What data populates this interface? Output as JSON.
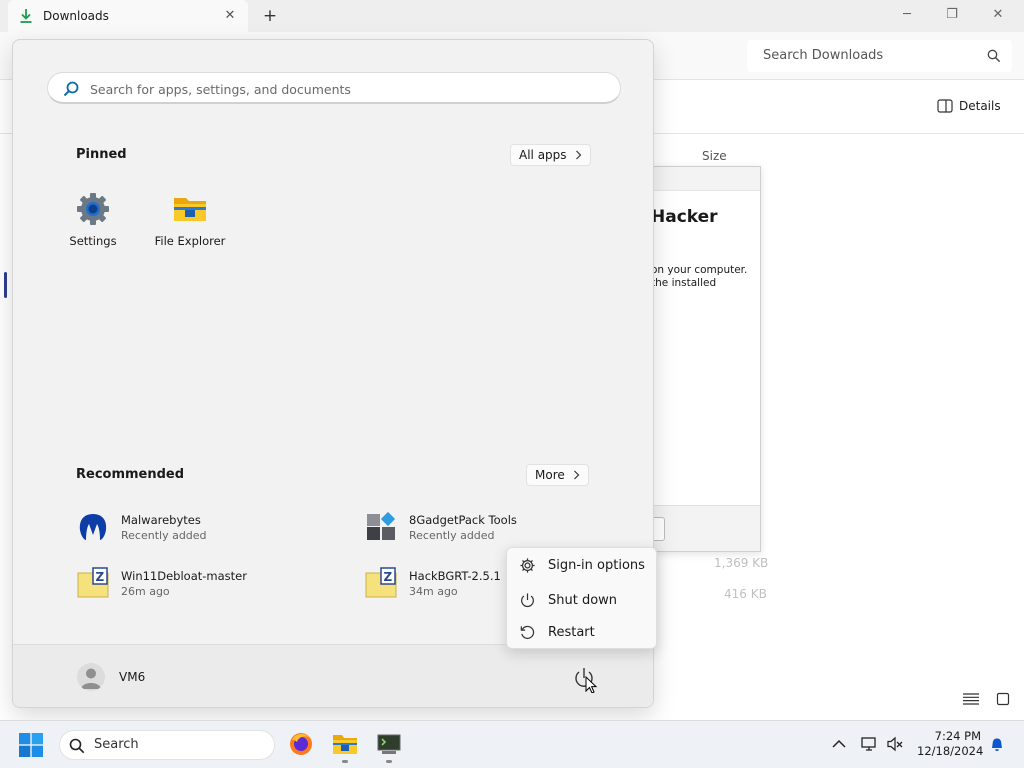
{
  "explorer": {
    "tab_title": "Downloads",
    "tab_close": "✕",
    "new_tab": "+",
    "minimize": "─",
    "restore": "❐",
    "close": "✕",
    "search_placeholder": "Search Downloads",
    "details_label": "Details",
    "column_size": "Size",
    "faded_sizes": [
      "1,369 KB",
      "416 KB"
    ]
  },
  "dialog": {
    "title": "Hacker",
    "text_line1": "on your computer.",
    "text_line2": "the installed"
  },
  "start_menu": {
    "search_placeholder": "Search for apps, settings, and documents",
    "pinned_title": "Pinned",
    "all_apps_label": "All apps",
    "pinned": [
      {
        "label": "Settings",
        "icon": "settings-icon"
      },
      {
        "label": "File Explorer",
        "icon": "file-explorer-icon"
      }
    ],
    "recommended_title": "Recommended",
    "more_label": "More",
    "recommended": [
      {
        "name": "Malwarebytes",
        "sub": "Recently added",
        "icon": "malwarebytes-icon"
      },
      {
        "name": "8GadgetPack Tools",
        "sub": "Recently added",
        "icon": "gadgetpack-icon"
      },
      {
        "name": "Win11Debloat-master",
        "sub": "26m ago",
        "icon": "zip-folder-icon"
      },
      {
        "name": "HackBGRT-2.5.1",
        "sub": "34m ago",
        "icon": "zip-folder-icon"
      }
    ],
    "user_name": "VM6"
  },
  "power_menu": {
    "items": [
      {
        "label": "Sign-in options",
        "icon": "gear-icon"
      },
      {
        "label": "Shut down",
        "icon": "power-icon"
      },
      {
        "label": "Restart",
        "icon": "restart-icon"
      }
    ]
  },
  "taskbar": {
    "search_label": "Search",
    "time": "7:24 PM",
    "date": "12/18/2024"
  },
  "colors": {
    "accent": "#0067c0",
    "start_bg": "#f2f2f2",
    "taskbar_bg": "#eef1f5"
  }
}
